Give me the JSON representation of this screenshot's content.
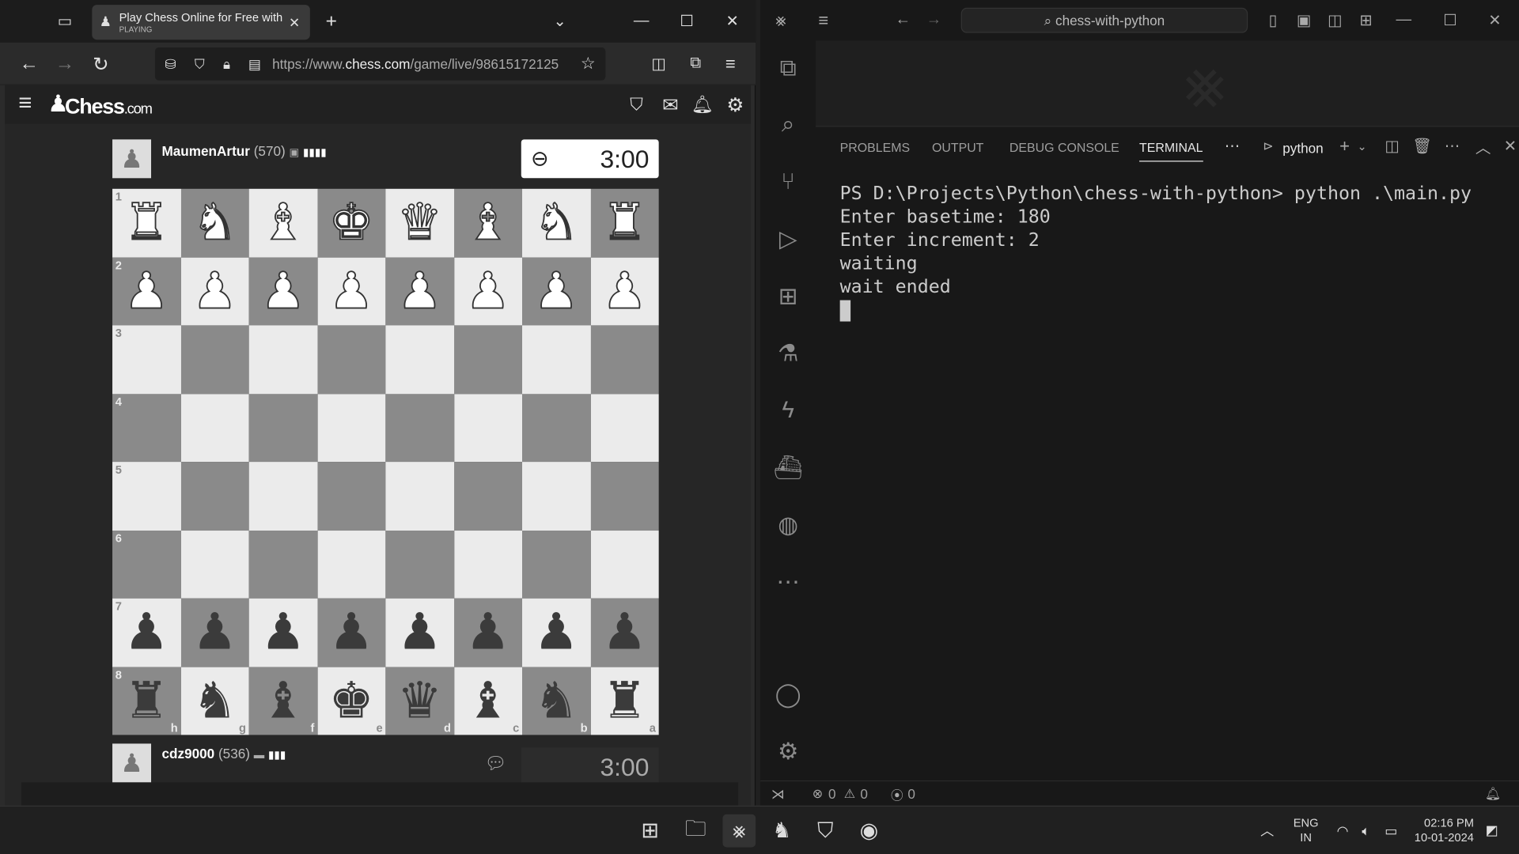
{
  "browser": {
    "tab": {
      "title": "Play Chess Online for Free with",
      "subtitle": "PLAYING"
    },
    "url_prefix": "https://www.",
    "url_domain": "chess.com",
    "url_path": "/game/live/98615172125"
  },
  "chess_site": {
    "logo_main": "Chess",
    "logo_suffix": ".com",
    "top_player": {
      "name": "MaumenArtur",
      "rating": "(570)",
      "clock": "3:00"
    },
    "bottom_player": {
      "name": "cdz9000",
      "rating": "(536)",
      "clock": "3:00"
    },
    "ranks": [
      "1",
      "2",
      "3",
      "4",
      "5",
      "6",
      "7",
      "8"
    ],
    "files": [
      "h",
      "g",
      "f",
      "e",
      "d",
      "c",
      "b",
      "a"
    ],
    "board": [
      [
        "wr",
        "wn",
        "wb",
        "wk",
        "wq",
        "wb",
        "wn",
        "wr"
      ],
      [
        "wp",
        "wp",
        "wp",
        "wp",
        "wp",
        "wp",
        "wp",
        "wp"
      ],
      [
        "",
        "",
        "",
        "",
        "",
        "",
        "",
        ""
      ],
      [
        "",
        "",
        "",
        "",
        "",
        "",
        "",
        ""
      ],
      [
        "",
        "",
        "",
        "",
        "",
        "",
        "",
        ""
      ],
      [
        "",
        "",
        "",
        "",
        "",
        "",
        "",
        ""
      ],
      [
        "bp",
        "bp",
        "bp",
        "bp",
        "bp",
        "bp",
        "bp",
        "bp"
      ],
      [
        "br",
        "bn",
        "bb",
        "bk",
        "bq",
        "bb",
        "bn",
        "br"
      ]
    ]
  },
  "vscode": {
    "command_center": "chess-with-python",
    "panel_tabs": [
      "PROBLEMS",
      "OUTPUT",
      "DEBUG CONSOLE",
      "TERMINAL"
    ],
    "terminal_name": "python",
    "terminal_lines": [
      "PS D:\\Projects\\Python\\chess-with-python> python .\\main.py",
      "Enter basetime: 180",
      "Enter increment: 2",
      "waiting",
      "wait ended"
    ],
    "status": {
      "errors": "0",
      "warnings": "0",
      "ports": "0"
    }
  },
  "taskbar": {
    "lang_1": "ENG",
    "lang_2": "IN",
    "time": "02:16 PM",
    "date": "10-01-2024"
  }
}
